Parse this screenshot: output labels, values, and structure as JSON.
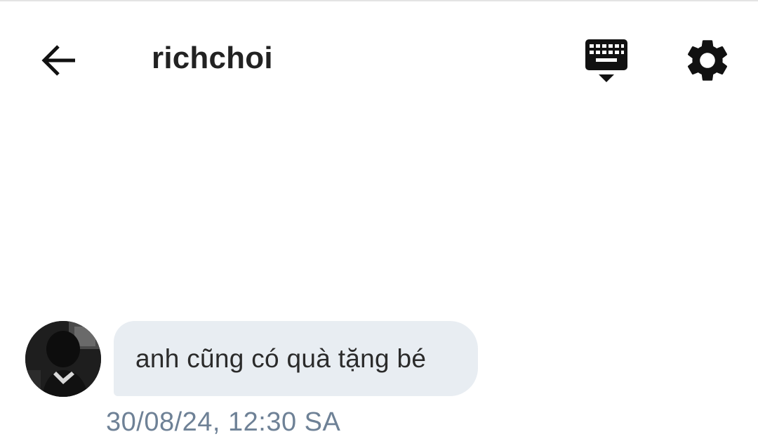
{
  "header": {
    "title": "richchoi",
    "back_icon": "arrow-left-icon",
    "keyboard_icon": "keyboard-hide-icon",
    "settings_icon": "gear-icon"
  },
  "conversation": {
    "messages": [
      {
        "sender_avatar": "avatar",
        "text": "anh cũng có quà tặng bé",
        "timestamp": "30/08/24, 12:30 SA"
      }
    ]
  },
  "colors": {
    "bubble_bg": "#e8edf2",
    "timestamp": "#6e8196",
    "title": "#222222"
  }
}
